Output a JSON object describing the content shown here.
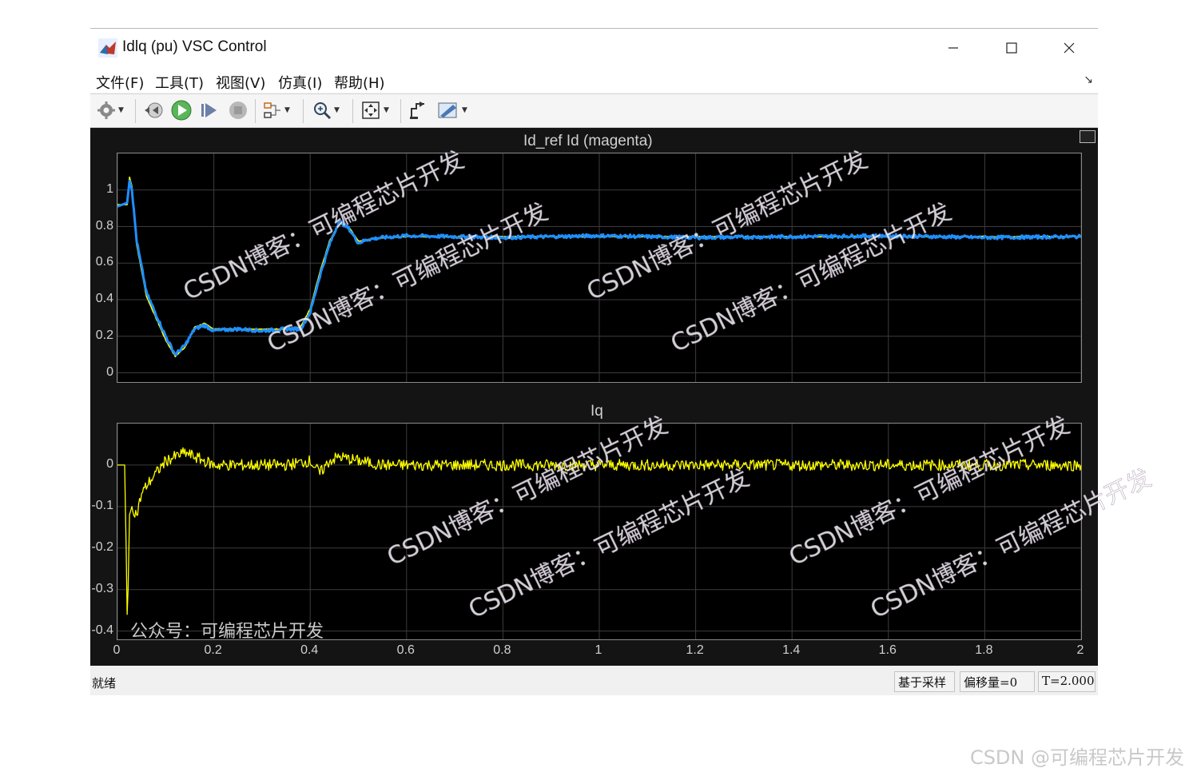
{
  "window": {
    "title": "Idlq (pu) VSC Control",
    "minimize_icon": "minimize-icon",
    "maximize_icon": "maximize-icon",
    "close_icon": "close-icon"
  },
  "menu": {
    "items": [
      "文件(F)",
      "工具(T)",
      "视图(V)",
      "仿真(I)",
      "帮助(H)"
    ]
  },
  "toolbar": {
    "icons": [
      "gear-icon",
      "step-back-icon",
      "run-icon",
      "step-forward-icon",
      "stop-icon",
      "signal-select-icon",
      "zoom-icon",
      "autoscale-icon",
      "restore-icon",
      "highlight-icon"
    ]
  },
  "chart_data": [
    {
      "type": "line",
      "title": "Id_ref   Id (magenta)",
      "xlim": [
        0,
        2
      ],
      "ylim": [
        -0.05,
        1.2
      ],
      "yticks": [
        "0",
        "0.2",
        "0.4",
        "0.6",
        "0.8",
        "1"
      ],
      "grid": true,
      "series": [
        {
          "color": "#ffff00",
          "x": [
            0,
            0.02,
            0.025,
            0.03,
            0.04,
            0.06,
            0.08,
            0.1,
            0.12,
            0.14,
            0.16,
            0.18,
            0.2,
            0.25,
            0.3,
            0.35,
            0.38,
            0.4,
            0.42,
            0.44,
            0.46,
            0.48,
            0.5,
            0.52,
            0.55,
            0.6,
            0.8,
            1.0,
            1.2,
            1.4,
            1.6,
            1.8,
            2.0
          ],
          "y": [
            0.92,
            0.92,
            1.07,
            1.02,
            0.7,
            0.42,
            0.3,
            0.18,
            0.09,
            0.14,
            0.25,
            0.27,
            0.24,
            0.24,
            0.24,
            0.24,
            0.25,
            0.35,
            0.55,
            0.72,
            0.82,
            0.8,
            0.72,
            0.73,
            0.74,
            0.745,
            0.745,
            0.745,
            0.745,
            0.745,
            0.745,
            0.745,
            0.745
          ]
        },
        {
          "color": "#1e90ff",
          "x": [
            0,
            0.02,
            0.025,
            0.03,
            0.04,
            0.06,
            0.08,
            0.1,
            0.12,
            0.14,
            0.16,
            0.18,
            0.2,
            0.25,
            0.3,
            0.35,
            0.38,
            0.4,
            0.42,
            0.44,
            0.46,
            0.48,
            0.5,
            0.52,
            0.55,
            0.6,
            0.8,
            1.0,
            1.2,
            1.4,
            1.6,
            1.8,
            2.0
          ],
          "y": [
            0.91,
            0.93,
            1.05,
            1.0,
            0.72,
            0.44,
            0.32,
            0.2,
            0.1,
            0.15,
            0.24,
            0.26,
            0.23,
            0.24,
            0.23,
            0.24,
            0.24,
            0.33,
            0.53,
            0.7,
            0.83,
            0.79,
            0.71,
            0.73,
            0.74,
            0.75,
            0.74,
            0.75,
            0.74,
            0.745,
            0.75,
            0.74,
            0.745
          ]
        }
      ]
    },
    {
      "type": "line",
      "title": "Iq",
      "xlim": [
        0,
        2
      ],
      "ylim": [
        -0.42,
        0.1
      ],
      "yticks": [
        "0",
        "-0.1",
        "-0.2",
        "-0.3",
        "-0.4"
      ],
      "xticks": [
        "0",
        "0.2",
        "0.4",
        "0.6",
        "0.8",
        "1",
        "1.2",
        "1.4",
        "1.6",
        "1.8",
        "2"
      ],
      "grid": true,
      "series": [
        {
          "color": "#ffff00",
          "x": [
            0,
            0.015,
            0.018,
            0.02,
            0.022,
            0.025,
            0.03,
            0.04,
            0.05,
            0.06,
            0.08,
            0.1,
            0.12,
            0.14,
            0.16,
            0.18,
            0.2,
            0.25,
            0.3,
            0.35,
            0.4,
            0.42,
            0.44,
            0.46,
            0.5,
            0.55,
            0.6,
            0.8,
            1.0,
            1.2,
            1.4,
            1.6,
            1.8,
            2.0
          ],
          "y": [
            0,
            0,
            -0.2,
            -0.36,
            -0.3,
            -0.12,
            -0.1,
            -0.12,
            -0.07,
            -0.05,
            -0.02,
            0.01,
            0.02,
            0.03,
            0.02,
            0.01,
            0,
            0,
            0,
            0,
            0.01,
            -0.02,
            0.01,
            0.02,
            0.01,
            0,
            0,
            0,
            0,
            0,
            0,
            0,
            0,
            0
          ]
        }
      ]
    }
  ],
  "scope": {
    "footer_label": "公众号：可编程芯片开发"
  },
  "status": {
    "ready": "就绪",
    "sample_based": "基于采样",
    "offset": "偏移量=0",
    "time": "T=2.000"
  },
  "watermark": {
    "line": "CSDN博客：可编程芯片开发",
    "credit": "CSDN @可编程芯片开发"
  }
}
